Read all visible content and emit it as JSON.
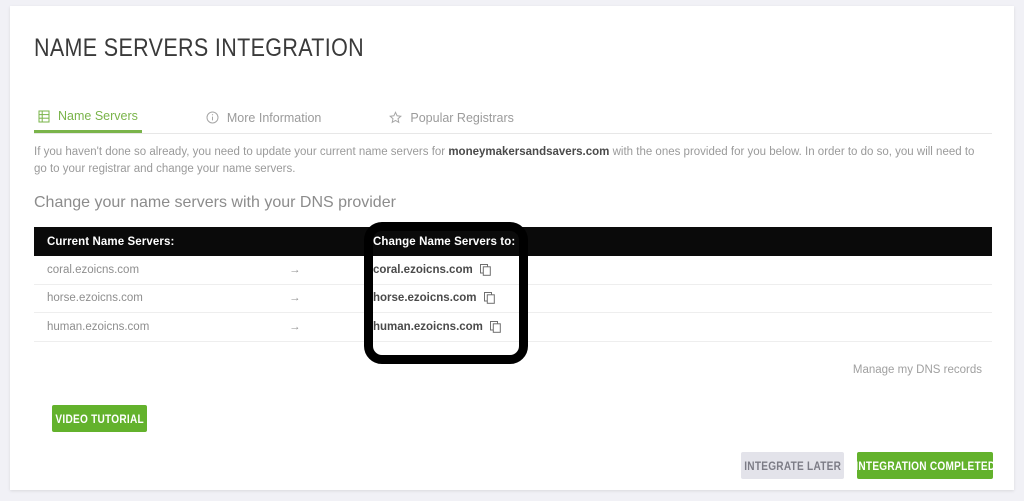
{
  "page": {
    "title": "NAME SERVERS INTEGRATION",
    "background_color": "#f1f1f6",
    "card_color": "#ffffff",
    "accent_color": "#63b22c"
  },
  "tabs": [
    {
      "label": "Name Servers",
      "icon": "server-icon",
      "active": true
    },
    {
      "label": "More Information",
      "icon": "info-circle-icon",
      "active": false
    },
    {
      "label": "Popular Registrars",
      "icon": "star-icon",
      "active": false
    }
  ],
  "description": {
    "part1": "If you haven't done so already, you need to update your current name servers for ",
    "domain": "moneymakersandsavers.com",
    "part2": " with the ones provided for you below. In order to do so, you will need to go to your registrar and change your name servers."
  },
  "subtitle": "Change your name servers with your DNS provider",
  "table": {
    "headers": {
      "current": "Current Name Servers:",
      "change_to": "Change Name Servers to:"
    },
    "arrow_glyph": "→",
    "rows": [
      {
        "current": "coral.ezoicns.com",
        "new": "coral.ezoicns.com",
        "copy_icon": "copy-icon"
      },
      {
        "current": "horse.ezoicns.com",
        "new": "horse.ezoicns.com",
        "copy_icon": "copy-icon"
      },
      {
        "current": "human.ezoicns.com",
        "new": "human.ezoicns.com",
        "copy_icon": "copy-icon"
      }
    ]
  },
  "links": {
    "manage_dns": "Manage my DNS records"
  },
  "buttons": {
    "video_tutorial": "VIDEO TUTORIAL",
    "integrate_later": "INTEGRATE LATER",
    "integration_completed": "INTEGRATION COMPLETED"
  },
  "annotation": {
    "name": "highlight-box",
    "color": "#000000"
  }
}
